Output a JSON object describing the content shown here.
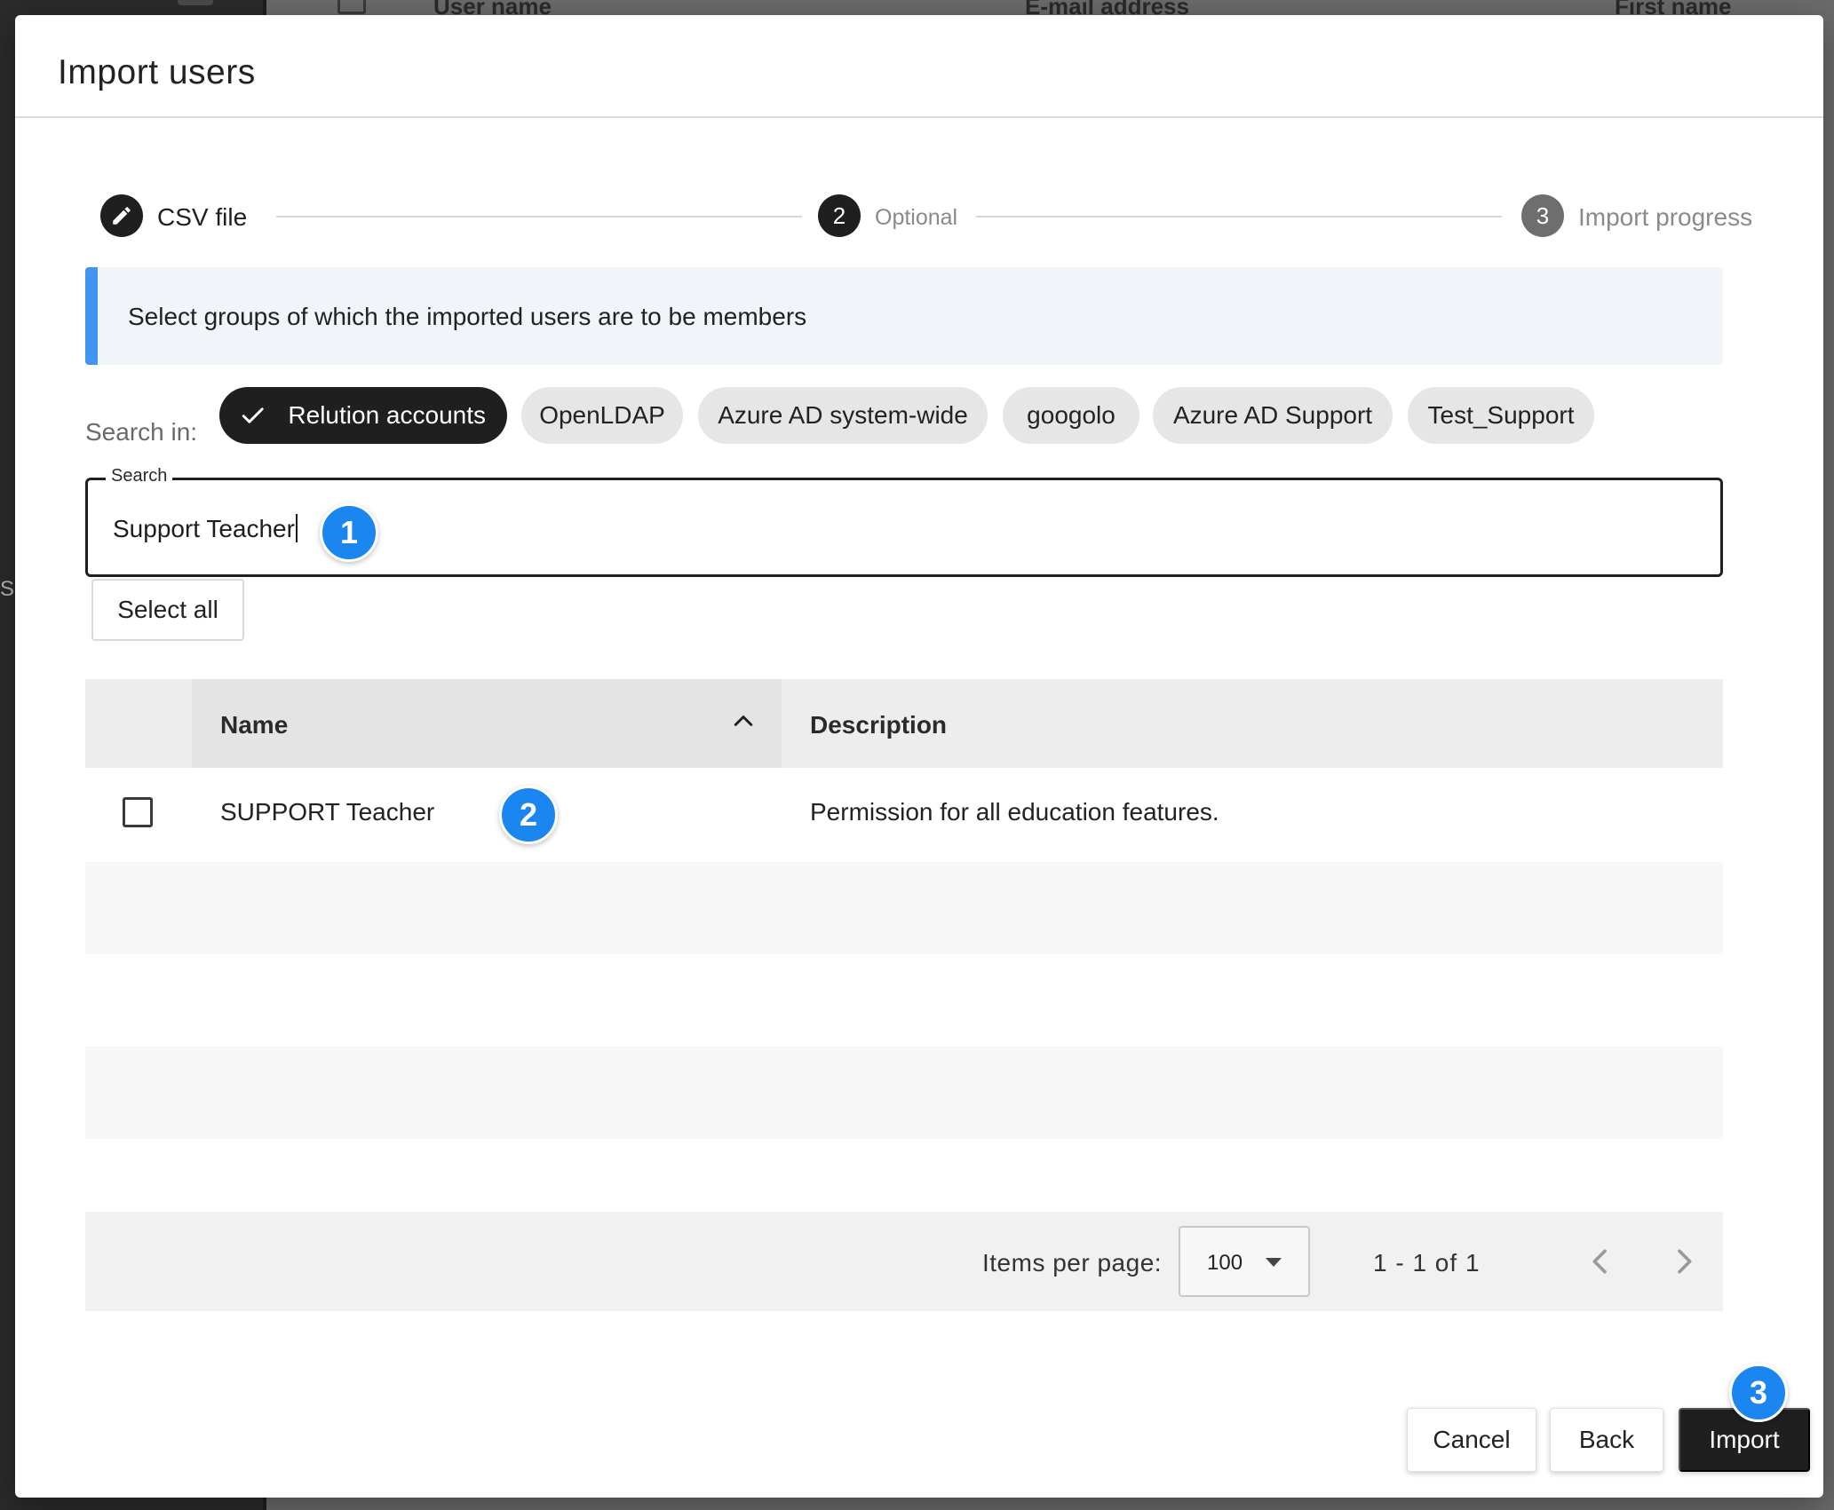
{
  "background": {
    "columns": [
      "User name",
      "E-mail address",
      "First name"
    ],
    "sidebar_letter": "S"
  },
  "dialog": {
    "title": "Import users",
    "stepper": {
      "steps": [
        {
          "number": "",
          "label": "CSV file",
          "icon": "pencil-icon"
        },
        {
          "number": "2",
          "label": "Optional"
        },
        {
          "number": "3",
          "label": "Import progress"
        }
      ]
    },
    "info": "Select groups of which the imported users are to be members",
    "search_in": {
      "label": "Search in:",
      "chips": [
        "Relution accounts",
        "OpenLDAP",
        "Azure AD system-wide",
        "googolo",
        "Azure AD Support",
        "Test_Support"
      ],
      "selected": "Relution accounts"
    },
    "search": {
      "legend": "Search",
      "value": "Support Teacher"
    },
    "select_all": "Select all",
    "table": {
      "columns": [
        "Name",
        "Description"
      ],
      "sort": "ascending",
      "rows": [
        {
          "name": "SUPPORT Teacher",
          "description": "Permission for all education features.",
          "checked": false
        }
      ]
    },
    "paginator": {
      "items_per_page_label": "Items per page:",
      "items_per_page": "100",
      "range": "1 - 1 of 1"
    },
    "buttons": {
      "cancel": "Cancel",
      "back": "Back",
      "import": "Import"
    },
    "badges": [
      "1",
      "2",
      "3"
    ]
  },
  "colors": {
    "accent_blue": "#4095f0",
    "badge_blue": "#1b86f0",
    "dark": "#1f1f1f"
  }
}
